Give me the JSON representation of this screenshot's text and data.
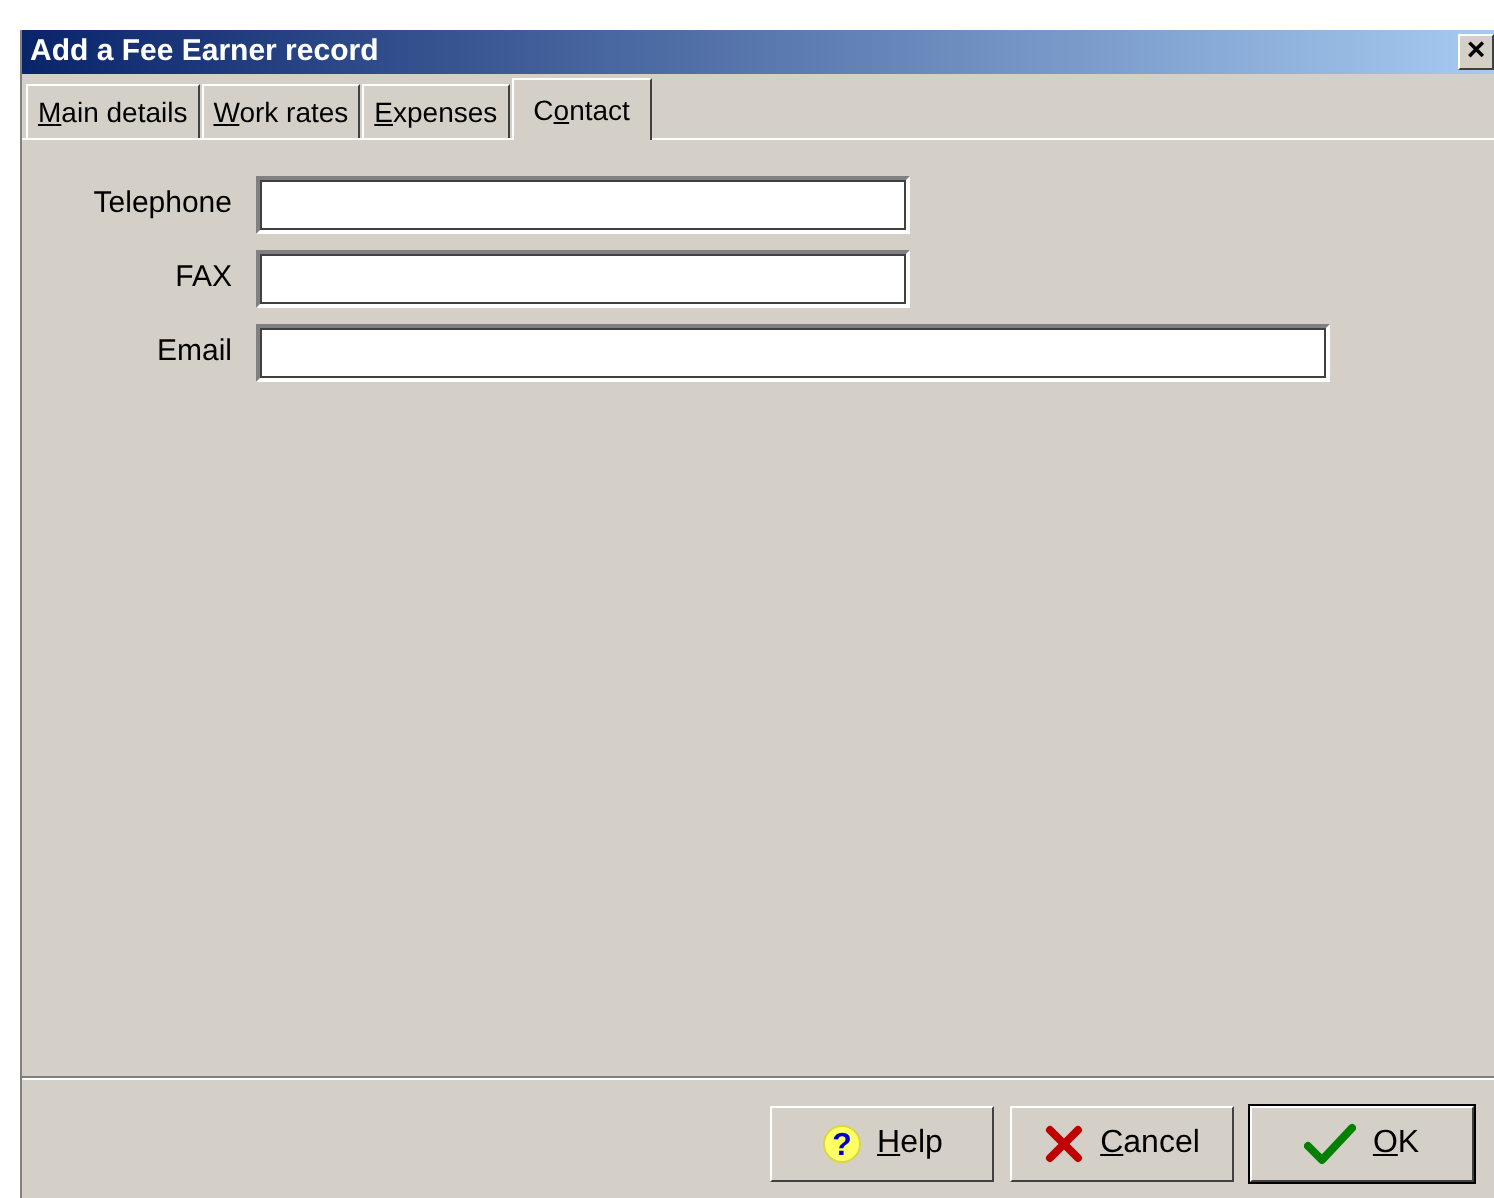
{
  "window": {
    "title": "Add a Fee Earner record",
    "close": "×"
  },
  "tabs": [
    {
      "key": "M",
      "post": "ain details",
      "selected": false
    },
    {
      "key": "W",
      "post": "ork rates",
      "selected": false
    },
    {
      "key": "E",
      "post": "xpenses",
      "selected": false
    },
    {
      "pre": "C",
      "key": "o",
      "post": "ntact",
      "selected": true
    }
  ],
  "fields": [
    {
      "label": "Telephone",
      "wide": false
    },
    {
      "label": "FAX",
      "wide": false
    },
    {
      "label": "Email",
      "wide": true
    }
  ],
  "buttons": [
    {
      "kind": "help",
      "glyph": "?",
      "key": "H",
      "post": "elp",
      "default": false
    },
    {
      "kind": "cancel",
      "key": "C",
      "post": "ancel",
      "default": false
    },
    {
      "kind": "ok",
      "key": "O",
      "post": "K",
      "default": true
    }
  ]
}
